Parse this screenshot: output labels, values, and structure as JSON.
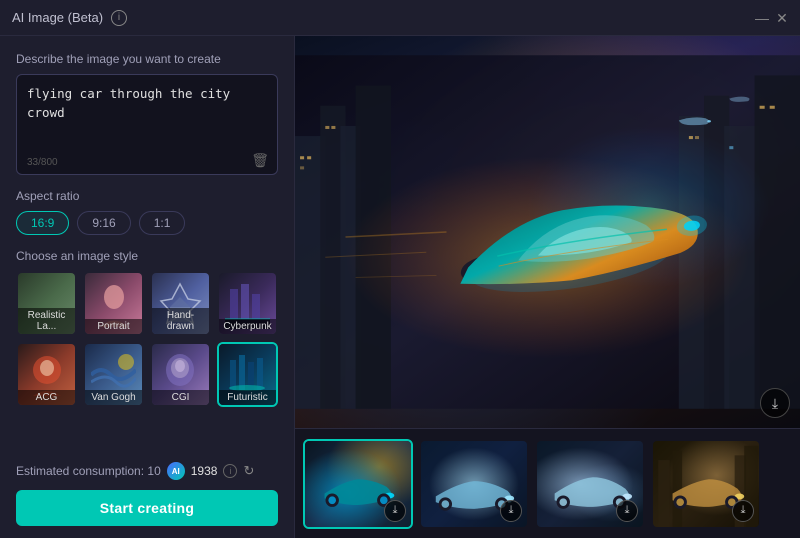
{
  "titleBar": {
    "title": "AI Image (Beta)",
    "minimizeLabel": "—",
    "closeLabel": "✕"
  },
  "leftPanel": {
    "promptLabel": "Describe the image you want to create",
    "promptValue": "flying car through the city crowd",
    "promptCounter": "33/800",
    "aspectRatio": {
      "label": "Aspect ratio",
      "options": [
        "16:9",
        "9:16",
        "1:1"
      ],
      "selected": "16:9"
    },
    "imageStyle": {
      "label": "Choose an image style",
      "styles": [
        {
          "id": "realistic",
          "label": "Realistic La...",
          "emoji": "🏔️"
        },
        {
          "id": "portrait",
          "label": "Portrait",
          "emoji": "👩"
        },
        {
          "id": "handdrawn",
          "label": "Hand-drawn",
          "emoji": "🏰"
        },
        {
          "id": "cyberpunk",
          "label": "Cyberpunk",
          "emoji": "🌆"
        },
        {
          "id": "acg",
          "label": "ACG",
          "emoji": "🎎"
        },
        {
          "id": "vangogh",
          "label": "Van Gogh",
          "emoji": "🌌"
        },
        {
          "id": "cgi",
          "label": "CGI",
          "emoji": "🎭"
        },
        {
          "id": "futuristic",
          "label": "Futuristic",
          "emoji": "🚀",
          "selected": true
        }
      ]
    },
    "consumption": {
      "label": "Estimated consumption: 10",
      "credits": "1938",
      "aiBadgeText": "AI"
    },
    "startButton": "Start creating"
  },
  "rightPanel": {
    "downloadIcon": "⤓",
    "thumbnails": [
      {
        "id": 1,
        "active": true
      },
      {
        "id": 2,
        "active": false
      },
      {
        "id": 3,
        "active": false
      },
      {
        "id": 4,
        "active": false
      }
    ]
  }
}
